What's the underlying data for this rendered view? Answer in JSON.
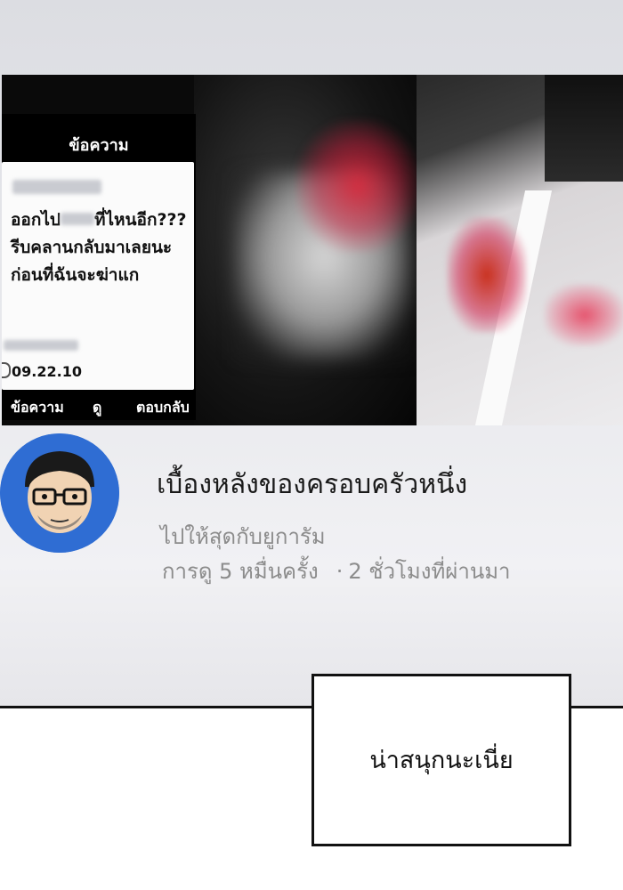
{
  "message_popup": {
    "header": "ข้อความ",
    "sender": "",
    "line1_before": "ออกไป",
    "line1_after": "ที่ไหนอีก???",
    "line2": "รีบคลานกลับมาเลยนะ",
    "line3": "ก่อนที่ฉันจะฆ่าแก",
    "timestamp": "09.22.10",
    "actions": {
      "message": "ข้อความ",
      "view": "ดู",
      "reply": "ตอบกลับ"
    }
  },
  "video": {
    "title": "เบื้องหลังของครอบครัวหนึ่ง",
    "channel": "ไปให้สุดกับยูการัม",
    "views": "การดู 5 หมื่นครั้ง",
    "separator": "·",
    "time_ago": "2 ชั่วโมงที่ผ่านมา",
    "avatar_color": "#2f6dd3"
  },
  "speech_bubble": {
    "text": "น่าสนุกนะเนี่ย"
  }
}
